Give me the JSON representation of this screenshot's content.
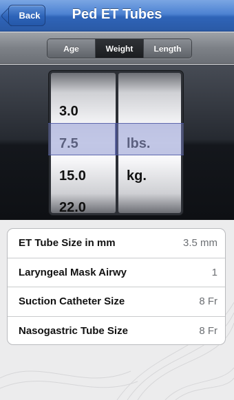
{
  "nav": {
    "back_label": "Back",
    "title": "Ped ET Tubes"
  },
  "segments": [
    {
      "label": "Age",
      "active": false
    },
    {
      "label": "Weight",
      "active": true
    },
    {
      "label": "Length",
      "active": false
    }
  ],
  "picker": {
    "weight_values": [
      "3.0",
      "7.5",
      "15.0",
      "22.0"
    ],
    "selected_weight": "7.5",
    "unit_values": [
      "lbs.",
      "kg."
    ],
    "selected_unit": "lbs."
  },
  "results": [
    {
      "label": "ET Tube Size in mm",
      "value": "3.5 mm"
    },
    {
      "label": "Laryngeal Mask Airwy",
      "value": "1"
    },
    {
      "label": "Suction Catheter Size",
      "value": "8 Fr"
    },
    {
      "label": "Nasogastric Tube Size",
      "value": "8 Fr"
    }
  ],
  "colors": {
    "nav_blue": "#2f64b8",
    "segment_active": "#1b1d20",
    "selection_overlay": "#7882c8"
  }
}
